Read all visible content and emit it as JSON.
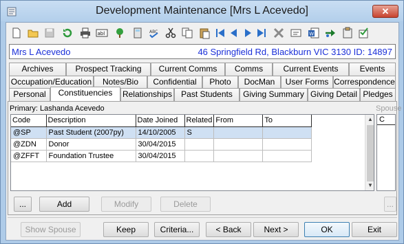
{
  "window": {
    "title": "Development Maintenance  [Mrs L Acevedo]",
    "close_label": "✕"
  },
  "toolbar": {
    "buttons": [
      {
        "name": "new-document-icon"
      },
      {
        "name": "open-folder-icon"
      },
      {
        "name": "save-disk-icon"
      },
      {
        "name": "refresh-icon"
      },
      {
        "name": "print-icon"
      },
      {
        "name": "text-ab-icon"
      },
      {
        "name": "tree-icon"
      },
      {
        "name": "calculator-icon"
      },
      {
        "name": "spellcheck-icon"
      },
      {
        "name": "cut-icon"
      },
      {
        "name": "copy-icon"
      },
      {
        "name": "paste-icon"
      },
      {
        "name": "first-record-icon"
      },
      {
        "name": "previous-record-icon"
      },
      {
        "name": "next-record-icon"
      },
      {
        "name": "last-record-icon"
      },
      {
        "name": "delete-x-icon"
      },
      {
        "name": "card-icon"
      },
      {
        "name": "word-document-icon"
      },
      {
        "name": "arrow-forward-icon"
      },
      {
        "name": "clipboard-icon"
      },
      {
        "name": "checklist-icon"
      }
    ]
  },
  "client": {
    "name": "Mrs L Acevedo",
    "address": "46 Springfield Rd, Blackburn VIC 3130 ID: 14897"
  },
  "tabs": {
    "row1": [
      "Archives",
      "Prospect Tracking",
      "Current Comms",
      "Comms",
      "Current Events",
      "Events"
    ],
    "row2": [
      "Occupation/Education",
      "Notes/Bio",
      "Confidential",
      "Photo",
      "DocMan",
      "User Forms",
      "Correspondence"
    ],
    "row3": [
      "Personal",
      "Constituencies",
      "Relationships",
      "Past Students",
      "Giving Summary",
      "Giving Detail",
      "Pledges"
    ],
    "active": "Constituencies"
  },
  "panel": {
    "primary_label": "Primary: Lashanda Acevedo",
    "spouse_label": "Spouse",
    "spouse_col": "C",
    "columns": [
      "Code",
      "Description",
      "Date Joined",
      "Related",
      "From",
      "To"
    ],
    "rows": [
      [
        "@SP",
        "Past Student  (2007py)",
        "14/10/2005",
        "S",
        "",
        ""
      ],
      [
        "@ZDN",
        "Donor",
        "30/04/2015",
        "",
        "",
        ""
      ],
      [
        "@ZFFT",
        "Foundation Trustee",
        "30/04/2015",
        "",
        "",
        ""
      ]
    ],
    "buttons": {
      "more": "...",
      "add": "Add",
      "modify": "Modify",
      "delete": "Delete",
      "spouse_more": "..."
    }
  },
  "footer": {
    "show_spouse": "Show Spouse",
    "keep": "Keep",
    "criteria": "Criteria...",
    "back": "< Back",
    "next": "Next >",
    "ok": "OK",
    "exit": "Exit"
  }
}
